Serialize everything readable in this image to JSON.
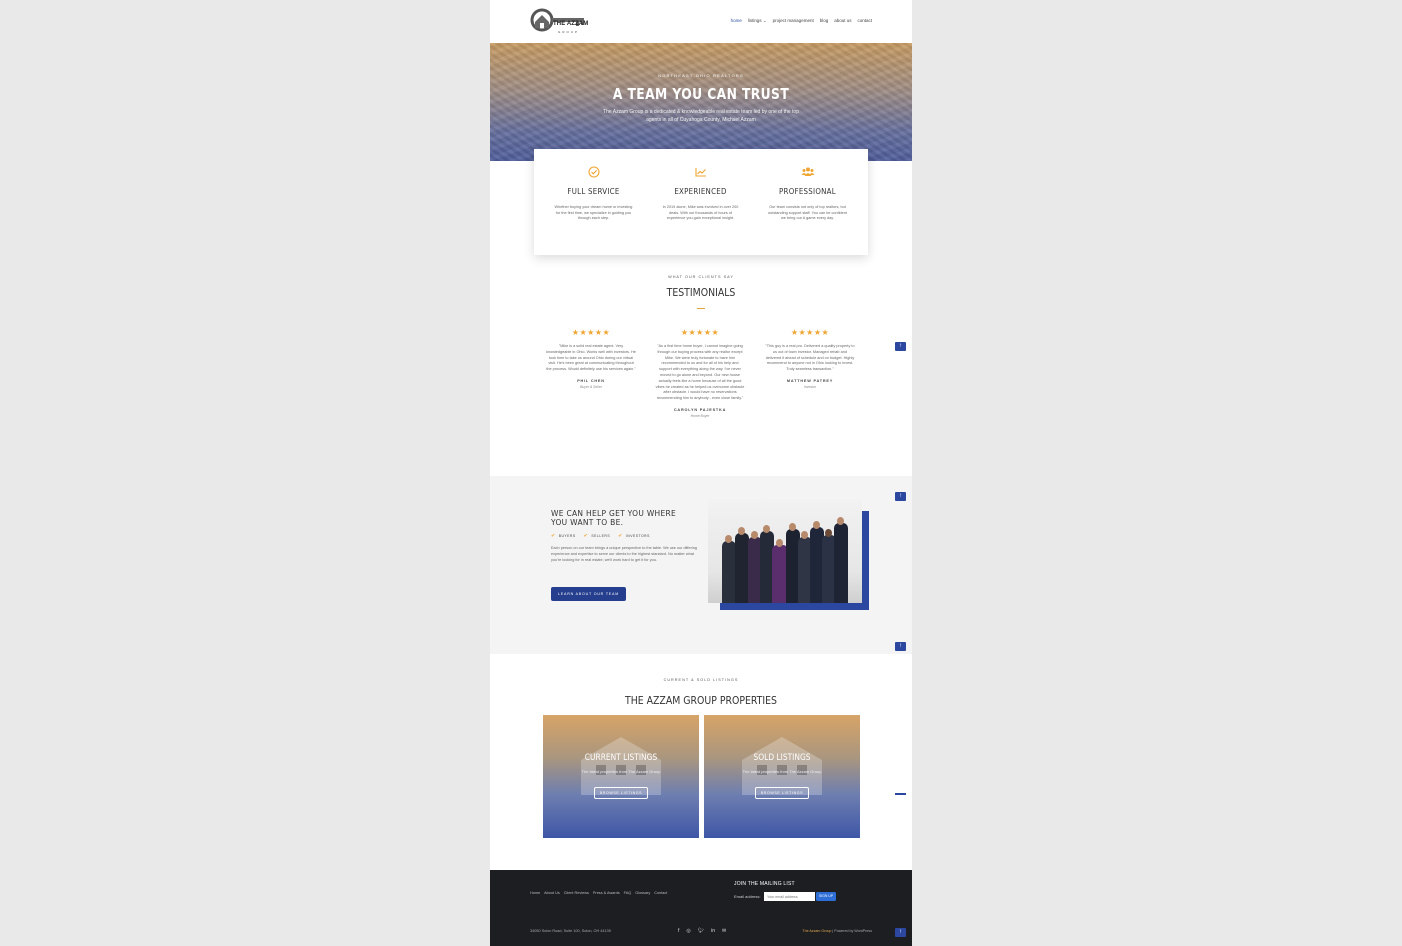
{
  "header": {
    "logo_text": "THE AZZAM",
    "logo_sub": "GROUP",
    "nav": [
      "home",
      "listings",
      "project management",
      "blog",
      "about us",
      "contact"
    ],
    "active_nav": "home"
  },
  "hero": {
    "eyebrow": "NORTHEAST OHIO REALTORS",
    "title": "A TEAM YOU CAN TRUST",
    "subtitle": "The Azzam Group is a dedicated & knowledgeable real estate team led by one of the top agents in all of Cuyahoga County, Michael Azzam"
  },
  "features": [
    {
      "icon": "check-circle-icon",
      "title": "FULL SERVICE",
      "text": "Whether buying your dream home or investing for the first time, we specialize in guiding you through each step."
    },
    {
      "icon": "chart-line-icon",
      "title": "EXPERIENCED",
      "text": "In 2019 alone, Mike was involved in over 200 deals. With our thousands of hours of experience you gain exceptional insight."
    },
    {
      "icon": "users-icon",
      "title": "PROFESSIONAL",
      "text": "Our team consists not only of top realtors, but outstanding support staff. You can be confident we bring our A game every day."
    }
  ],
  "testimonials": {
    "eyebrow": "WHAT OUR CLIENTS SAY",
    "title": "TESTIMONIALS",
    "items": [
      {
        "stars": "★★★★★",
        "quote": "\"Mike is a solid real estate agent. Very knowledgeable in Ohio. Works well with investors. He took time to take us around Ohio during our virtual visit. He's been great at communicating throughout the process. Would definitely use his services again.\"",
        "name": "PHIL CHEN",
        "role": "Buyer & Seller"
      },
      {
        "stars": "★★★★★",
        "quote": "\"As a first time home buyer, I cannot imagine going through our buying process with any realtor except Mike. We were truly fortunate to have him recommended to us and for all of his help and support with everything along the way. I've never moved to go alone and beyond. Our new house actually feels like a home because of all the good vibes he created as he helped us overcome obstacle after obstacle. I would have no reservations recommending him to anybody - even close family.\"",
        "name": "CAROLYN PAJESTKA",
        "role": "Home Buyer"
      },
      {
        "stars": "★★★★★",
        "quote": "\"This guy is a real pro. Delivered a quality property to us out of town investor. Managed rehab and delivered it ahead of schedule and on budget. Highly recommend to anyone not in Ohio looking to invest. Truly seamless transaction.\"",
        "name": "MATTHEW PATREY",
        "role": "Investor"
      }
    ]
  },
  "help": {
    "title": "WE CAN HELP GET YOU WHERE YOU WANT TO BE.",
    "checks": [
      "BUYERS",
      "SELLERS",
      "INVESTORS"
    ],
    "text": "Each person on our team brings a unique perspective to the table. We use our differing experience and expertise to serve our clients to the highest standard. No matter what you're looking for in real estate, we'll work hard to get it for you.",
    "button": "LEARN ABOUT OUR TEAM"
  },
  "listings": {
    "eyebrow": "CURRENT & SOLD LISTINGS",
    "title": "THE AZZAM GROUP PROPERTIES",
    "cards": [
      {
        "title": "CURRENT LISTINGS",
        "subtitle": "The latest properties from The Azzam Group",
        "button": "BROWSE LISTINGS"
      },
      {
        "title": "SOLD LISTINGS",
        "subtitle": "The latest properties from The Azzam Group",
        "button": "BROWSE LISTINGS"
      }
    ]
  },
  "footer": {
    "links": [
      "Home",
      "About Us",
      "Client Reviews",
      "Press & Awards",
      "FAQ",
      "Glossary",
      "Contact"
    ],
    "mailing_title": "JOIN THE MAILING LIST",
    "email_label": "Email address:",
    "email_placeholder": "Your email address",
    "signup": "SIGN UP",
    "address": "34050 Solon Road, Suite 100, Solon, OH 44139",
    "social": [
      "facebook-icon",
      "instagram-icon",
      "twitter-icon",
      "linkedin-icon",
      "email-icon"
    ],
    "credit_brand": "The Azzam Group",
    "credit_rest": " | Powered by WordPress"
  },
  "scroll_top": "↑",
  "colors": {
    "accent_blue": "#253f8e",
    "gold": "#f0a531",
    "footer_bg": "#1c1e22"
  }
}
